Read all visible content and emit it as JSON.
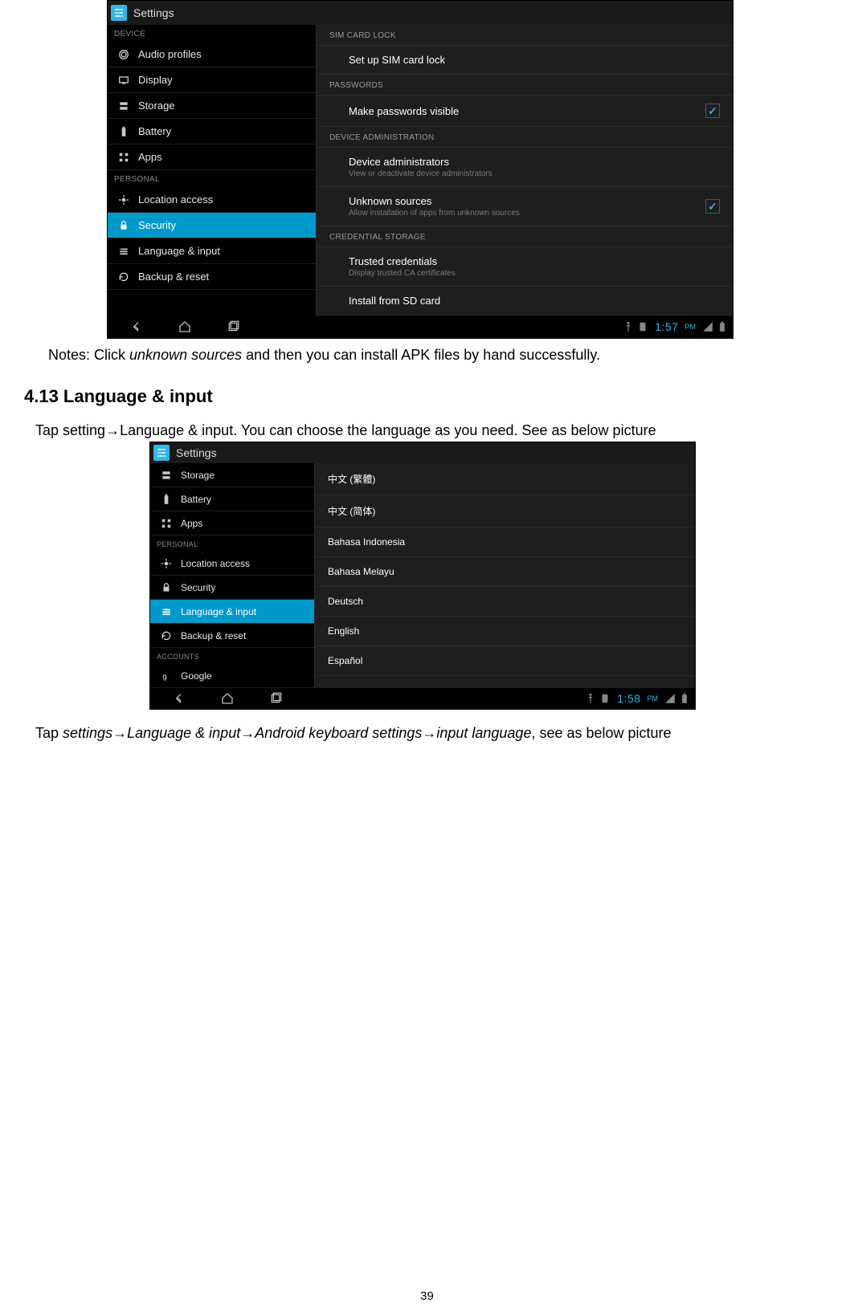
{
  "shot1": {
    "title": "Settings",
    "left_sections": [
      {
        "header": "DEVICE",
        "items": [
          {
            "key": "audio",
            "label": "Audio profiles"
          },
          {
            "key": "display",
            "label": "Display"
          },
          {
            "key": "storage",
            "label": "Storage"
          },
          {
            "key": "battery",
            "label": "Battery"
          },
          {
            "key": "apps",
            "label": "Apps"
          }
        ]
      },
      {
        "header": "PERSONAL",
        "items": [
          {
            "key": "location",
            "label": "Location access"
          },
          {
            "key": "security",
            "label": "Security",
            "selected": true
          },
          {
            "key": "lang",
            "label": "Language & input"
          },
          {
            "key": "backup",
            "label": "Backup & reset"
          }
        ]
      }
    ],
    "right": {
      "groups": [
        {
          "header": "SIM CARD LOCK",
          "rows": [
            {
              "main": "Set up SIM card lock"
            }
          ]
        },
        {
          "header": "PASSWORDS",
          "rows": [
            {
              "main": "Make passwords visible",
              "check": true
            }
          ]
        },
        {
          "header": "DEVICE ADMINISTRATION",
          "rows": [
            {
              "main": "Device administrators",
              "sub": "View or deactivate device administrators"
            },
            {
              "main": "Unknown sources",
              "sub": "Allow installation of apps from unknown sources",
              "check": true
            }
          ]
        },
        {
          "header": "CREDENTIAL STORAGE",
          "rows": [
            {
              "main": "Trusted credentials",
              "sub": "Display trusted CA certificates"
            },
            {
              "main": "Install from SD card"
            }
          ]
        }
      ]
    },
    "clock": "1:57",
    "ampm": "PM"
  },
  "doc": {
    "notes_pre": "Notes: Click ",
    "notes_it": "unknown sources",
    "notes_post": " and then you can install APK files by hand successfully.",
    "heading": "4.13 Language & input",
    "para1_a": "Tap setting",
    "para1_b": "Language & input. You can choose the language as you need. See as below picture",
    "para2_a": "Tap ",
    "para2_b": "settings",
    "para2_c": "Language & input",
    "para2_d": "Android keyboard settings",
    "para2_e": "input language",
    "para2_f": ", see as below picture",
    "arrow": "→"
  },
  "shot2": {
    "title": "Settings",
    "left": {
      "top_items": [
        {
          "key": "storage",
          "label": "Storage"
        },
        {
          "key": "battery",
          "label": "Battery"
        },
        {
          "key": "apps",
          "label": "Apps"
        }
      ],
      "personal_header": "PERSONAL",
      "personal_items": [
        {
          "key": "location",
          "label": "Location access"
        },
        {
          "key": "security",
          "label": "Security"
        },
        {
          "key": "lang",
          "label": "Language & input",
          "selected": true
        },
        {
          "key": "backup",
          "label": "Backup & reset"
        }
      ],
      "accounts_header": "ACCOUNTS",
      "accounts_items": [
        {
          "key": "google",
          "label": "Google"
        }
      ]
    },
    "languages": [
      "中文 (繁體)",
      "中文 (简体)",
      "Bahasa Indonesia",
      "Bahasa Melayu",
      "Deutsch",
      "English",
      "Español"
    ],
    "clock": "1:58",
    "ampm": "PM"
  },
  "page_number": "39"
}
